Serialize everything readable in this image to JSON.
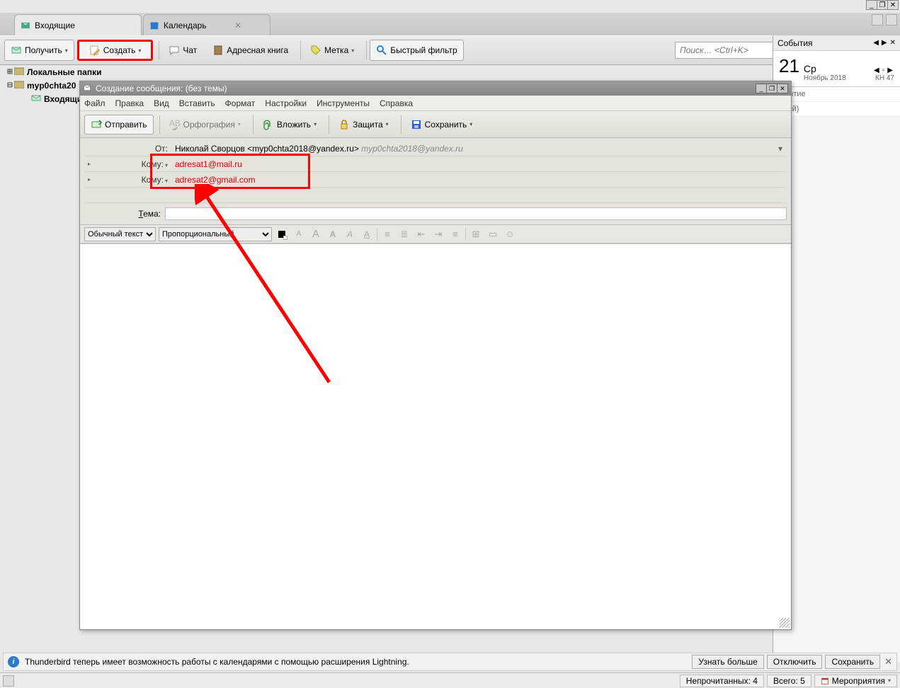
{
  "window_controls": {
    "min": "_",
    "max": "❐",
    "close": "✕"
  },
  "tabs": [
    {
      "label": "Входящие",
      "icon": "inbox-icon"
    },
    {
      "label": "Календарь",
      "icon": "calendar-icon",
      "closable": true
    }
  ],
  "toolbar": {
    "receive": "Получить",
    "compose": "Создать",
    "chat": "Чат",
    "addressbook": "Адресная книга",
    "tag": "Метка",
    "quickfilter": "Быстрый фильтр",
    "search_placeholder": "Поиск… <Ctrl+K>"
  },
  "tree": {
    "local_folders": "Локальные папки",
    "account": "myp0chta20",
    "inbox": "Входящи"
  },
  "events": {
    "title": "События",
    "daynum": "21",
    "dayname": "Ср",
    "month": "Ноябрь 2018",
    "week": "КН 47",
    "new_event": "обытие",
    "days_suffix": "дней)"
  },
  "compose": {
    "title": "Создание сообщения: (без темы)",
    "menu": {
      "file": "Файл",
      "edit": "Правка",
      "view": "Вид",
      "insert": "Вставить",
      "format": "Формат",
      "options": "Настройки",
      "tools": "Инструменты",
      "help": "Справка"
    },
    "tb": {
      "send": "Отправить",
      "spell": "Орфография",
      "attach": "Вложить",
      "security": "Защита",
      "save": "Сохранить"
    },
    "from_label": "От:",
    "from_name": "Николай Сворцов <myp0chta2018@yandex.ru>",
    "from_grey": "myp0chta2018@yandex.ru",
    "to_label": "Кому:",
    "recipients": [
      "adresat1@mail.ru",
      "adresat2@gmail.com"
    ],
    "subject_label": "Тема:",
    "subject_value": "",
    "format": {
      "text_mode": "Обычный текст",
      "font": "Пропорциональный"
    }
  },
  "infobar": {
    "text": "Thunderbird теперь имеет возможность работы с календарями с помощью расширения Lightning.",
    "learn": "Узнать больше",
    "disable": "Отключить",
    "keep": "Сохранить"
  },
  "statusbar": {
    "unread": "Непрочитанных: 4",
    "total": "Всего: 5",
    "agenda": "Мероприятия"
  }
}
